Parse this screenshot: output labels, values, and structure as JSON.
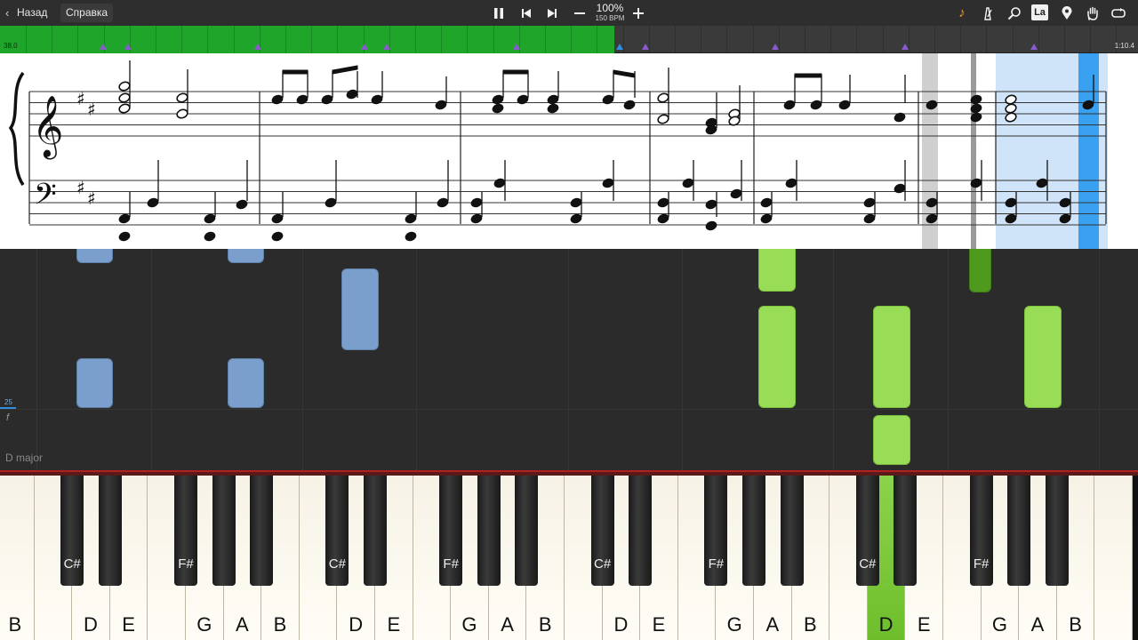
{
  "toolbar": {
    "back_label": "Назад",
    "help_label": "Справка",
    "tempo_percent": "100%",
    "tempo_bpm": "150 BPM",
    "la_label": "La",
    "icons": [
      "pause-icon",
      "skip-back-icon",
      "skip-forward-icon",
      "minus-icon",
      "plus-icon",
      "note-icon",
      "metronome-icon",
      "search-icon",
      "la-icon",
      "location-pin-icon",
      "hand-icon",
      "loop-icon"
    ]
  },
  "progress": {
    "start_time": "38.0",
    "end_time": "1:10.4",
    "played_fraction": 0.54,
    "colors": {
      "played": "#1fa52a",
      "remaining": "#3a3a3a",
      "marker": "#8a5ad0"
    }
  },
  "sheet": {
    "clefs": [
      "treble",
      "bass"
    ],
    "key_signature": "D major (2 sharps)"
  },
  "roll": {
    "key_label": "D major",
    "velocity_number": "25",
    "dynamic": "f",
    "colors": {
      "left_hand": "#7b9fcc",
      "right_hand": "#98dd55",
      "active": "#4f9a1e"
    }
  },
  "keyboard": {
    "white_keys": [
      "B",
      "C",
      "D",
      "E",
      "F",
      "G",
      "A",
      "B",
      "C",
      "D",
      "E",
      "F",
      "G",
      "A",
      "B",
      "C",
      "D",
      "E",
      "F",
      "G",
      "A",
      "B",
      "C",
      "D",
      "E",
      "F",
      "G",
      "A",
      "B",
      "C"
    ],
    "white_labels_shown": [
      "B",
      "",
      "D",
      "E",
      "",
      "G",
      "A",
      "B",
      "",
      "D",
      "E",
      "",
      "G",
      "A",
      "B",
      "",
      "D",
      "E",
      "",
      "G",
      "A",
      "B",
      "",
      "D",
      "E",
      "",
      "G",
      "A",
      "B",
      ""
    ],
    "black_labels": [
      "C#",
      "F#",
      "C#",
      "F#",
      "C#",
      "F#",
      "C#",
      "F#",
      "C#"
    ],
    "active_key": "D"
  }
}
